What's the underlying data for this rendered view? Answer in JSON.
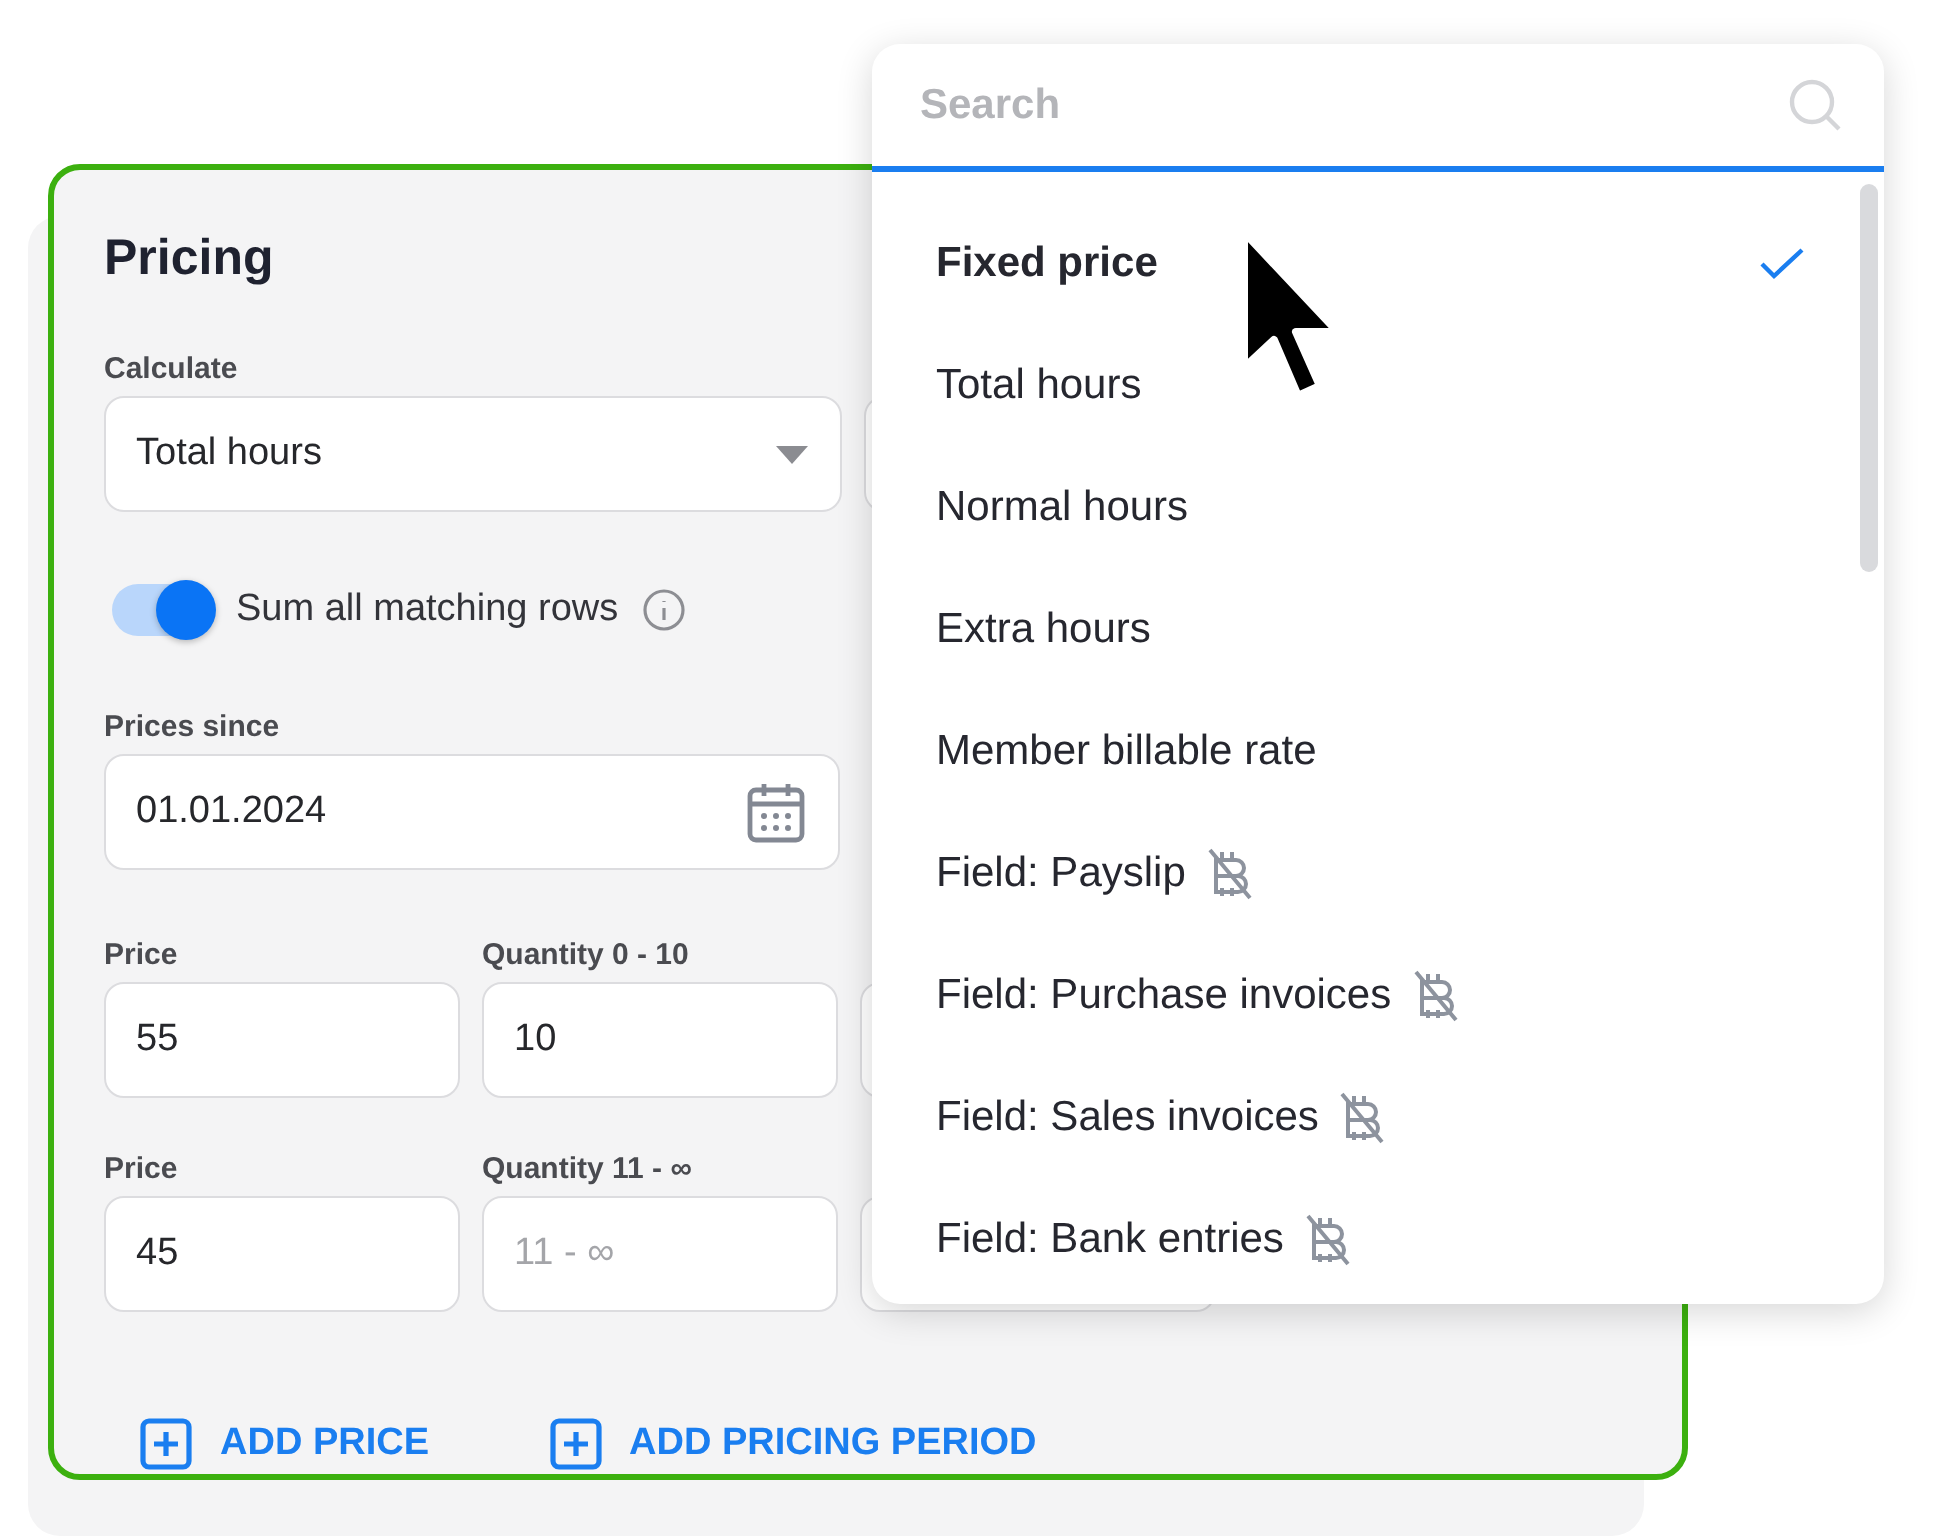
{
  "card": {
    "title": "Pricing",
    "calculate": {
      "label": "Calculate",
      "value": "Total hours"
    },
    "toggle": {
      "label": "Sum all matching rows",
      "on": true
    },
    "prices_since": {
      "label": "Prices since",
      "value": "01.01.2024"
    },
    "price_rows": [
      {
        "price_label": "Price",
        "price_value": "55",
        "quantity_label": "Quantity 0 - 10",
        "quantity_value": "10"
      },
      {
        "price_label": "Price",
        "price_value": "45",
        "quantity_label": "Quantity 11 - ∞",
        "quantity_placeholder": "11 - ∞"
      }
    ],
    "actions": [
      "ADD PRICE",
      "ADD PRICING PERIOD"
    ]
  },
  "dropdown": {
    "search": {
      "placeholder": "Search"
    },
    "options": [
      {
        "label": "Fixed price",
        "selected": true,
        "unavailable": false
      },
      {
        "label": "Total hours",
        "selected": false,
        "unavailable": false
      },
      {
        "label": "Normal hours",
        "selected": false,
        "unavailable": false
      },
      {
        "label": "Extra hours",
        "selected": false,
        "unavailable": false
      },
      {
        "label": "Member billable rate",
        "selected": false,
        "unavailable": false
      },
      {
        "label": "Field: Payslip",
        "selected": false,
        "unavailable": true
      },
      {
        "label": "Field: Purchase invoices",
        "selected": false,
        "unavailable": true
      },
      {
        "label": "Field: Sales invoices",
        "selected": false,
        "unavailable": true
      },
      {
        "label": "Field: Bank entries",
        "selected": false,
        "unavailable": true
      }
    ]
  }
}
